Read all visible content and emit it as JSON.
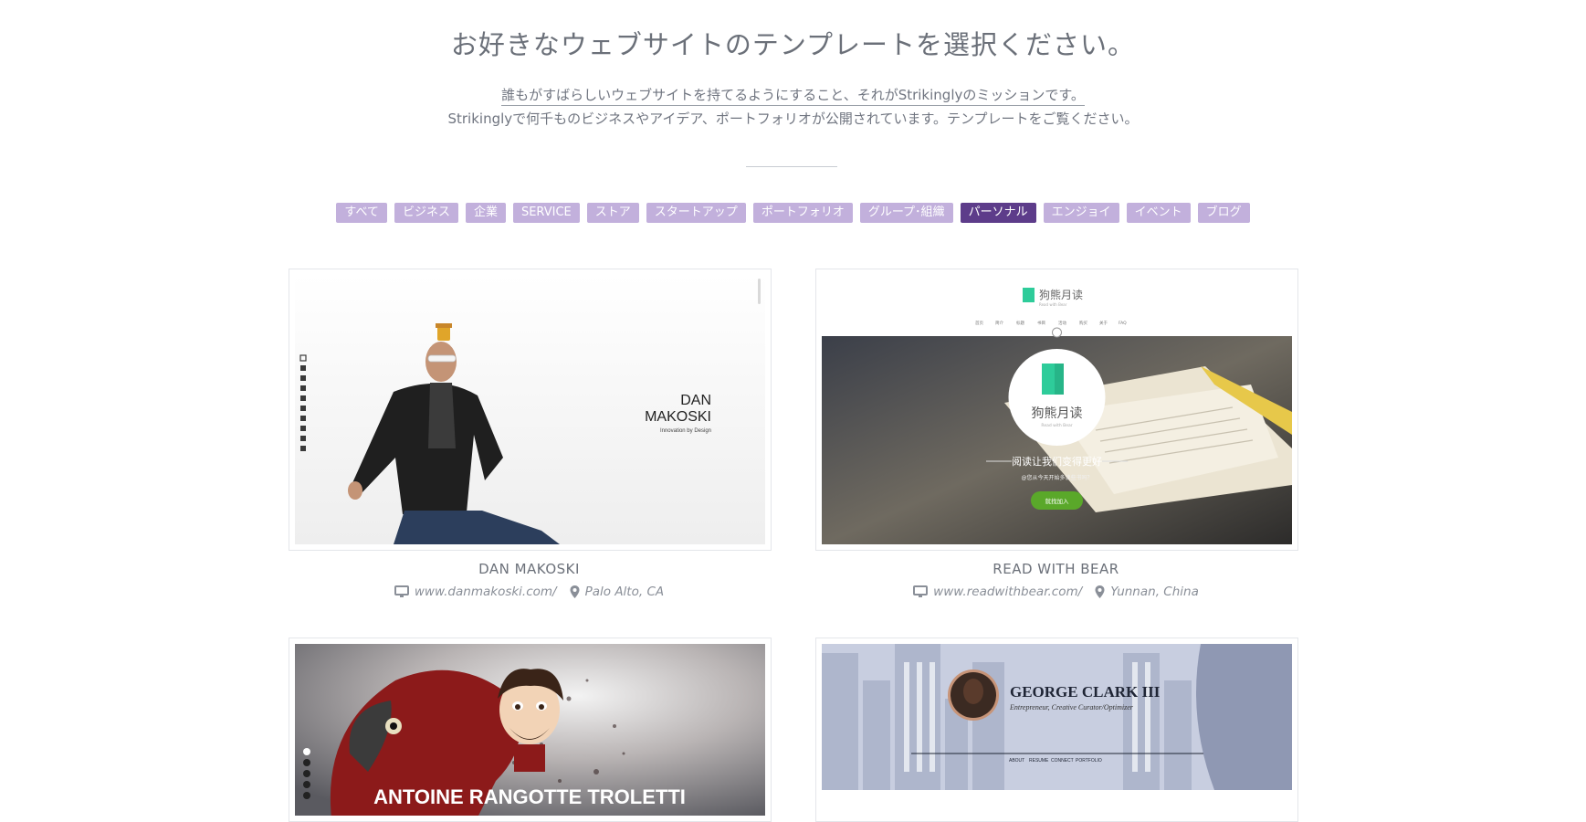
{
  "header": {
    "title": "お好きなウェブサイトのテンプレートを選択ください。",
    "line1": "誰もがすばらしいウェブサイトを持てるようにすること、それがStrikinglyのミッションです。",
    "line2": "Strikinglyで何千ものビジネスやアイデア、ポートフォリオが公開されています。テンプレートをご覧ください。"
  },
  "filters": [
    "すべて",
    "ビジネス",
    "企業",
    "SERVICE",
    "ストア",
    "スタートアップ",
    "ポートフォリオ",
    "グループ･組織",
    "パーソナル",
    "エンジョイ",
    "イベント",
    "ブログ"
  ],
  "active_filter": "パーソナル",
  "colors": {
    "chip": "#c2b0dc",
    "chip_active": "#5d3c8a",
    "book_green": "#2ecc9a",
    "join_button": "#5aa82a"
  },
  "cards": [
    {
      "name": "DAN MAKOSKI",
      "url": "www.danmakoski.com/",
      "location": "Palo Alto, CA",
      "preview": {
        "heading_line1": "DAN",
        "heading_line2": "MAKOSKI",
        "tagline": "Innovation by Design"
      }
    },
    {
      "name": "READ WITH BEAR",
      "url": "www.readwithbear.com/",
      "location": "Yunnan, China",
      "preview": {
        "logo": "狗熊月读",
        "logo_sub": "Read with Bear",
        "nav": [
          "首页",
          "简介",
          "标题",
          "书目",
          "活动",
          "购买",
          "关于",
          "FAQ"
        ],
        "circle_title": "狗熊月读",
        "circle_sub": "Read with Bear",
        "headline": "阅读让我们变得更好",
        "subline": "@您从今天开始多读些书吗？",
        "button": "就找加入"
      }
    },
    {
      "name": "",
      "preview": {
        "heading": "ANTOINE RANGOTTE TROLETTI"
      }
    },
    {
      "name": "",
      "preview": {
        "heading": "GEORGE CLARK III",
        "tagline": "Entrepreneur, Creative Curator/Optimizer",
        "nav": [
          "ABOUT",
          "RESUME",
          "CONNECT",
          "PORTFOLIO"
        ]
      }
    }
  ]
}
